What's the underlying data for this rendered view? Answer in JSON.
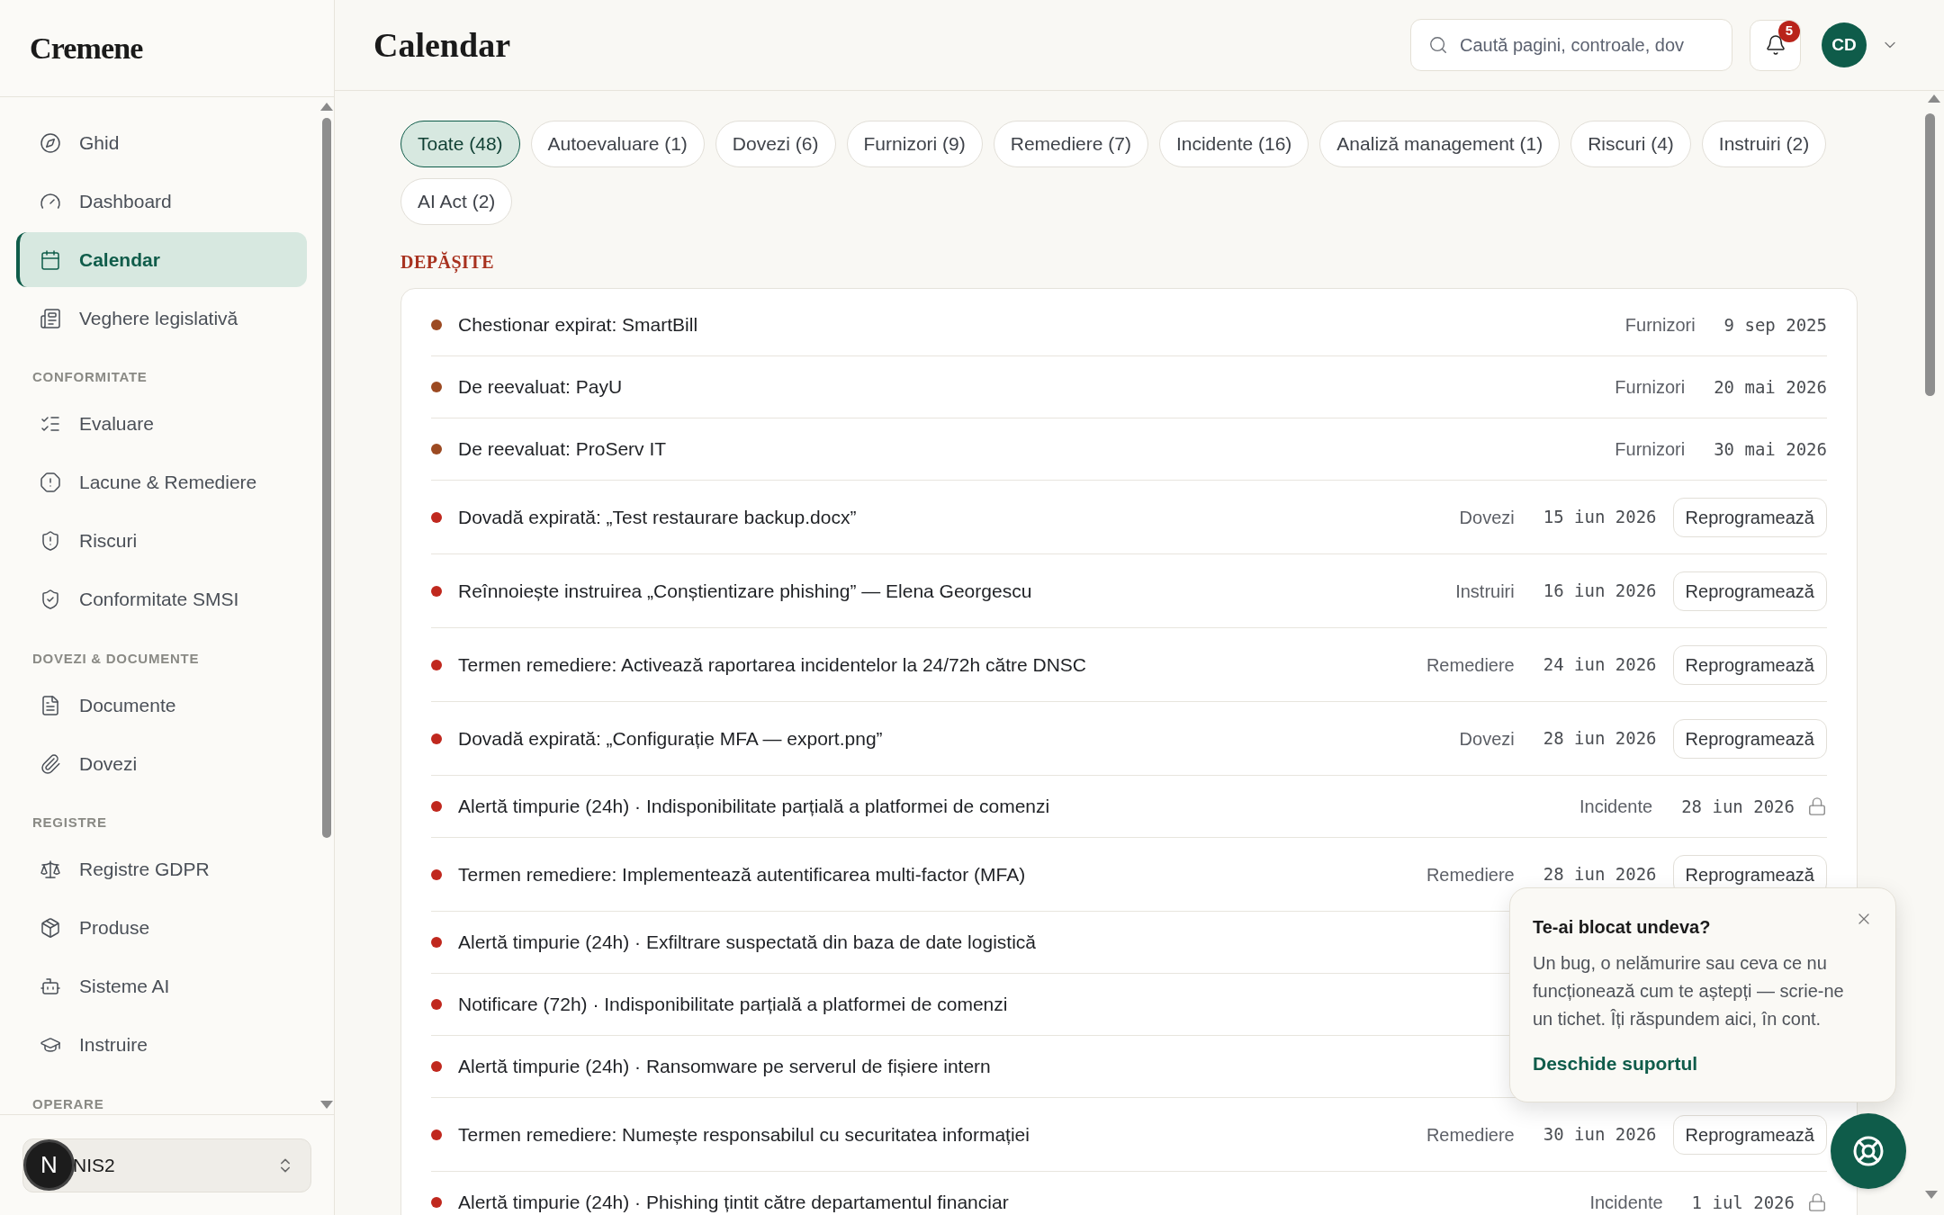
{
  "brand": "Cremene",
  "sidebar": {
    "sections": [
      {
        "items": [
          {
            "label": "Ghid",
            "selected": false
          },
          {
            "label": "Dashboard",
            "selected": false
          },
          {
            "label": "Calendar",
            "selected": true
          },
          {
            "label": "Veghere legislativă",
            "selected": false
          }
        ]
      },
      {
        "title": "CONFORMITATE",
        "items": [
          {
            "label": "Evaluare",
            "selected": false
          },
          {
            "label": "Lacune & Remediere",
            "selected": false
          },
          {
            "label": "Riscuri",
            "selected": false
          },
          {
            "label": "Conformitate SMSI",
            "selected": false
          }
        ]
      },
      {
        "title": "DOVEZI & DOCUMENTE",
        "items": [
          {
            "label": "Documente",
            "selected": false
          },
          {
            "label": "Dovezi",
            "selected": false
          }
        ]
      },
      {
        "title": "REGISTRE",
        "items": [
          {
            "label": "Registre GDPR",
            "selected": false
          },
          {
            "label": "Produse",
            "selected": false
          },
          {
            "label": "Sisteme AI",
            "selected": false
          },
          {
            "label": "Instruire",
            "selected": false
          }
        ]
      },
      {
        "title": "OPERARE"
      }
    ],
    "workspace": {
      "value": "NIS2",
      "avatar": "N"
    }
  },
  "header": {
    "title": "Calendar",
    "search": {
      "placeholder": "Caută pagini, controale, dov"
    },
    "notifications": "5",
    "user": "CD"
  },
  "filters": [
    {
      "label": "Toate (48)",
      "selected": true
    },
    {
      "label": "Autoevaluare (1)",
      "selected": false
    },
    {
      "label": "Dovezi (6)",
      "selected": false
    },
    {
      "label": "Furnizori (9)",
      "selected": false
    },
    {
      "label": "Remediere (7)",
      "selected": false
    },
    {
      "label": "Incidente (16)",
      "selected": false
    },
    {
      "label": "Analiză management (1)",
      "selected": false
    },
    {
      "label": "Riscuri (4)",
      "selected": false
    },
    {
      "label": "Instruiri (2)",
      "selected": false
    },
    {
      "label": "AI Act (2)",
      "selected": false
    }
  ],
  "section_title": "DEPĂȘITE",
  "events": [
    {
      "title": "Chestionar expirat: SmartBill",
      "color": "#9c4a22",
      "category": "Furnizori",
      "date": "9 sep 2025",
      "kind": "plain"
    },
    {
      "title": "De reevaluat: PayU",
      "color": "#9c4a22",
      "category": "Furnizori",
      "date": "20 mai 2026",
      "kind": "plain"
    },
    {
      "title": "De reevaluat: ProServ IT",
      "color": "#9c4a22",
      "category": "Furnizori",
      "date": "30 mai 2026",
      "kind": "plain"
    },
    {
      "title": "Dovadă expirată: „Test restaurare backup.docx”",
      "color": "#c0281e",
      "category": "Dovezi",
      "date": "15 iun 2026",
      "kind": "action",
      "action": "Reprogramează"
    },
    {
      "title": "Reînnoiește instruirea „Conștientizare phishing” — Elena Georgescu",
      "color": "#c0281e",
      "category": "Instruiri",
      "date": "16 iun 2026",
      "kind": "action",
      "action": "Reprogramează"
    },
    {
      "title": "Termen remediere: Activează raportarea incidentelor la 24/72h către DNSC",
      "color": "#c0281e",
      "category": "Remediere",
      "date": "24 iun 2026",
      "kind": "action",
      "action": "Reprogramează"
    },
    {
      "title": "Dovadă expirată: „Configurație MFA — export.png”",
      "color": "#c0281e",
      "category": "Dovezi",
      "date": "28 iun 2026",
      "kind": "action",
      "action": "Reprogramează"
    },
    {
      "title": "Alertă timpurie (24h) · Indisponibilitate parțială a platformei de comenzi",
      "color": "#c0281e",
      "category": "Incidente",
      "date": "28 iun 2026",
      "kind": "locked"
    },
    {
      "title": "Termen remediere: Implementează autentificarea multi-factor (MFA)",
      "color": "#c0281e",
      "category": "Remediere",
      "date": "28 iun 2026",
      "kind": "action",
      "action": "Reprogramează"
    },
    {
      "title": "Alertă timpurie (24h) · Exfiltrare suspectată din baza de date logistică",
      "color": "#c0281e",
      "kind": "hidden"
    },
    {
      "title": "Notificare (72h) · Indisponibilitate parțială a platformei de comenzi",
      "color": "#c0281e",
      "kind": "hidden"
    },
    {
      "title": "Alertă timpurie (24h) · Ransomware pe serverul de fișiere intern",
      "color": "#c0281e",
      "kind": "hidden"
    },
    {
      "title": "Termen remediere: Numește responsabilul cu securitatea informației",
      "color": "#c0281e",
      "category": "Remediere",
      "date": "30 iun 2026",
      "kind": "action",
      "action": "Reprogramează"
    },
    {
      "title": "Alertă timpurie (24h) · Phishing țintit către departamentul financiar",
      "color": "#c0281e",
      "category": "Incidente",
      "date": "1 iul 2026",
      "kind": "locked"
    }
  ],
  "help_popup": {
    "title": "Te-ai blocat undeva?",
    "body": "Un bug, o nelămurire sau ceva ce nu funcționează cum te aștepți — scrie-ne un tichet. Îți răspundem aici, în cont.",
    "link": "Deschide suportul"
  }
}
